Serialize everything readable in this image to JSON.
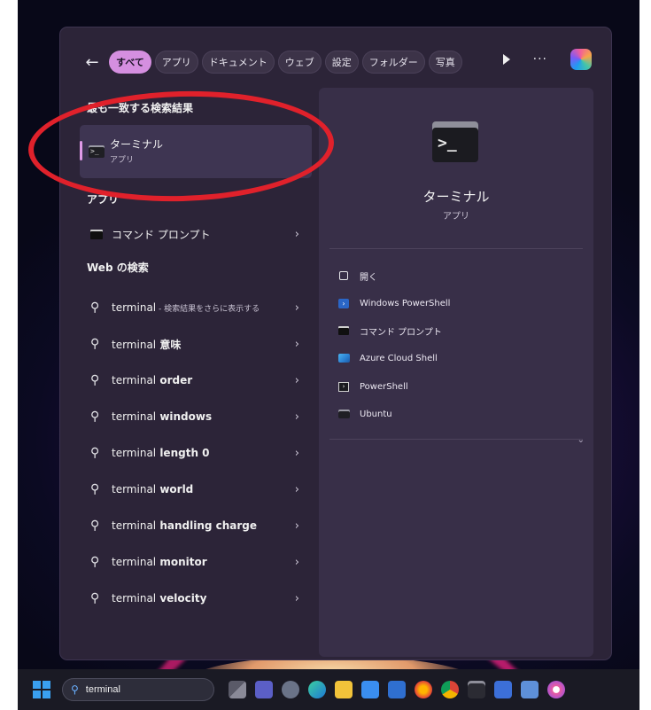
{
  "filters": {
    "items": [
      "すべて",
      "アプリ",
      "ドキュメント",
      "ウェブ",
      "設定",
      "フォルダー",
      "写真"
    ],
    "active_index": 0
  },
  "best_match": {
    "heading": "最も一致する検索結果",
    "name": "ターミナル",
    "type": "アプリ"
  },
  "apps": {
    "heading": "アプリ",
    "items": [
      {
        "name": "コマンド プロンプト"
      }
    ]
  },
  "web": {
    "heading": "Web の検索",
    "first": {
      "query": "terminal",
      "suffix": " - 検索結果をさらに表示する"
    },
    "items": [
      {
        "query": "terminal",
        "bold": " 意味"
      },
      {
        "query": "terminal",
        "bold": " order"
      },
      {
        "query": "terminal",
        "bold": " windows"
      },
      {
        "query": "terminal",
        "bold": " length 0"
      },
      {
        "query": "terminal",
        "bold": " world"
      },
      {
        "query": "terminal",
        "bold": " handling charge"
      },
      {
        "query": "terminal",
        "bold": " monitor"
      },
      {
        "query": "terminal",
        "bold": " velocity"
      }
    ]
  },
  "detail": {
    "name": "ターミナル",
    "type": "アプリ",
    "actions": [
      {
        "label": "開く",
        "icon": "open-icon"
      },
      {
        "label": "Windows PowerShell",
        "icon": "powershell-icon"
      },
      {
        "label": "コマンド プロンプト",
        "icon": "command-prompt-icon"
      },
      {
        "label": "Azure Cloud Shell",
        "icon": "azure-cloud-shell-icon"
      },
      {
        "label": "PowerShell",
        "icon": "powershell-7-icon"
      },
      {
        "label": "Ubuntu",
        "icon": "ubuntu-icon"
      }
    ]
  },
  "taskbar": {
    "search_value": "terminal",
    "icons": [
      "task-view-icon",
      "teams-icon",
      "settings-icon",
      "edge-icon",
      "file-explorer-icon",
      "store-icon",
      "mail-icon",
      "firefox-icon",
      "chrome-icon",
      "terminal-icon",
      "snipping-tool-icon",
      "remote-desktop-icon",
      "itunes-icon"
    ]
  },
  "colors": {
    "accent": "#d58fe0",
    "annotation": "#e0212b",
    "panel": "#2c2438"
  }
}
